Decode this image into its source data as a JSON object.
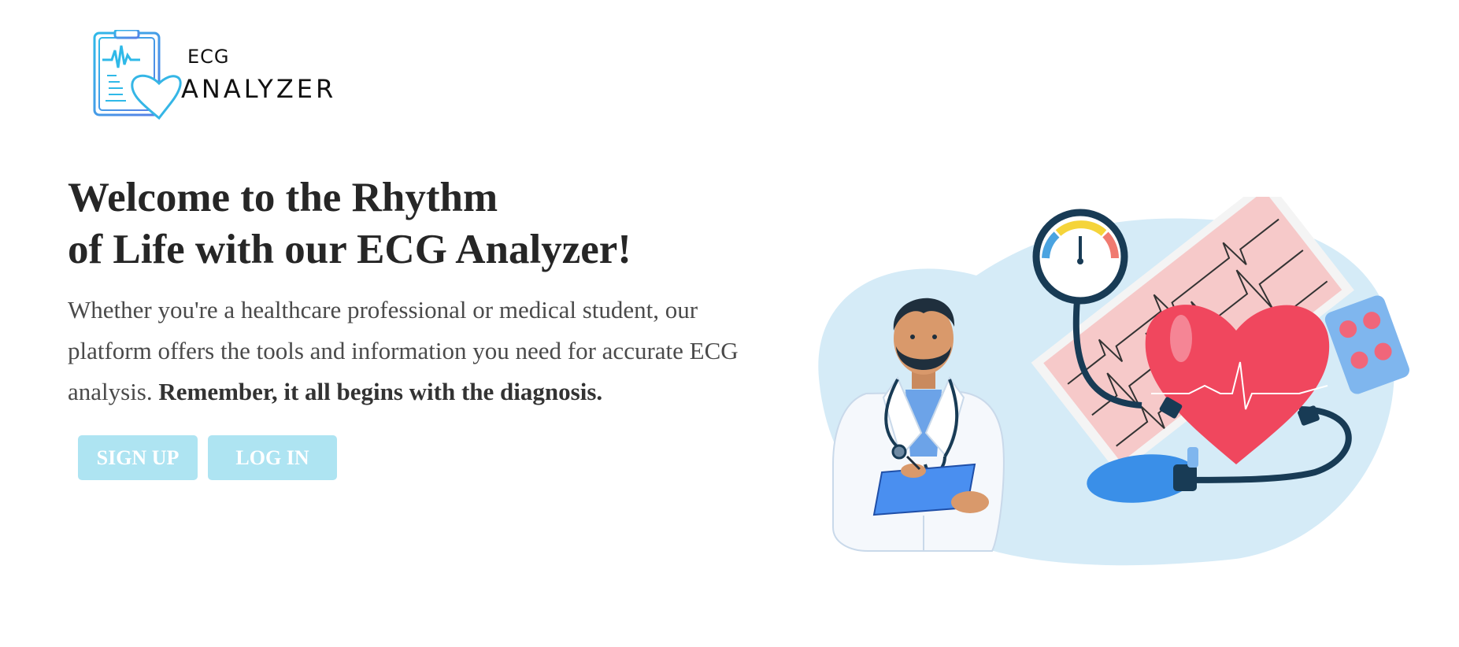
{
  "logo": {
    "small_text": "ECG",
    "big_text": "ANALYZER",
    "icon": "clipboard-heart-icon"
  },
  "hero": {
    "headline_line1": "Welcome to the Rhythm",
    "headline_line2": "of Life with our ECG Analyzer!",
    "lead_text": "Whether you're a healthcare professional or medical student, our platform offers the tools and information you need for accurate ECG analysis. ",
    "lead_bold": "Remember, it all begins with the diagnosis."
  },
  "buttons": {
    "signup_label": "SIGN UP",
    "login_label": "LOG IN"
  },
  "illustration": {
    "icon": "doctor-heart-ecg-illustration"
  },
  "colors": {
    "button_bg": "#aee4f2",
    "logo_blue": "#3bb6e6",
    "heart_red": "#f0475e"
  }
}
